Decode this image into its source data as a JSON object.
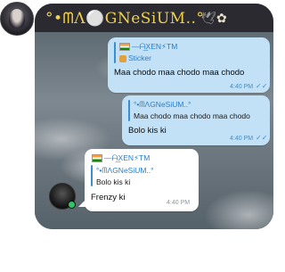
{
  "header": {
    "chat_name": "°•ᗰΛ⚪GNeSiUM..°",
    "icons": [
      "leaf-icon",
      "bird-icon",
      "flower-icon"
    ],
    "prefix": "°•",
    "name_body": "ᗰΛ⚪GNeSiUM..",
    "suffix_glyph": "𝄞"
  },
  "messages": {
    "m1": {
      "reply_sender": "—ᗩ͜XEN⚡TM",
      "reply_text": "Sticker",
      "text": "Maa chodo maa chodo maa chodo",
      "time": "4:40 PM"
    },
    "m2": {
      "reply_sender": "°•ᗰΛGNeSiUM..°",
      "reply_text": "Maa chodo maa chodo maa chodo",
      "text": "Bolo kis ki",
      "time": "4:40 PM"
    },
    "m3": {
      "sender": "—ᗩ͜XEN⚡TM",
      "reply_sender": "°•ᗰΛGNeSiUM..°",
      "reply_text": "Bolo kis ki",
      "text": "Frenzy ki",
      "time": "4:40 PM"
    }
  },
  "colors": {
    "outgoing_bubble": "#c2e1f7",
    "incoming_bubble": "#ffffff",
    "header_name": "#f0d24a",
    "link_blue": "#2b7dc4"
  }
}
